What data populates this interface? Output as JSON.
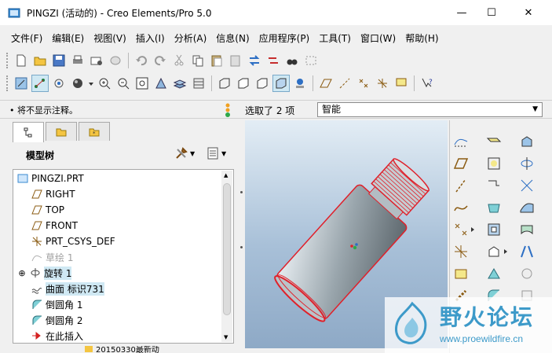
{
  "window": {
    "title": "PINGZI (活动的) - Creo Elements/Pro 5.0",
    "minimize": "—",
    "maximize": "☐",
    "close": "✕"
  },
  "menu": [
    "文件(F)",
    "编辑(E)",
    "视图(V)",
    "插入(I)",
    "分析(A)",
    "信息(N)",
    "应用程序(P)",
    "工具(T)",
    "窗口(W)",
    "帮助(H)"
  ],
  "status": {
    "message": "• 将不显示注释。",
    "selection": "选取了 2 项",
    "filter_value": "智能"
  },
  "model_tree": {
    "title": "模型树",
    "nodes": [
      {
        "label": "PINGZI.PRT",
        "icon": "part-icon"
      },
      {
        "label": "RIGHT",
        "icon": "datum-plane-icon"
      },
      {
        "label": "TOP",
        "icon": "datum-plane-icon"
      },
      {
        "label": "FRONT",
        "icon": "datum-plane-icon"
      },
      {
        "label": "PRT_CSYS_DEF",
        "icon": "csys-icon"
      },
      {
        "label": "草绘 1",
        "icon": "sketch-icon",
        "dimmed": true
      },
      {
        "label": "旋转 1",
        "icon": "revolve-icon",
        "selected": true,
        "expandable": true
      },
      {
        "label": "曲面 标识731",
        "icon": "surface-icon",
        "selected": true
      },
      {
        "label": "倒圆角 1",
        "icon": "round-icon"
      },
      {
        "label": "倒圆角 2",
        "icon": "round-icon"
      },
      {
        "label": "在此插入",
        "icon": "insert-here-icon"
      }
    ]
  },
  "taskbar": {
    "item": "20150330最新动"
  },
  "watermark": {
    "title": "野火论坛",
    "url": "www.proewildfire.cn"
  },
  "colors": {
    "selection": "#cfe8f3",
    "highlight_edges": "#e0202a",
    "accent": "#3d9ac9"
  }
}
